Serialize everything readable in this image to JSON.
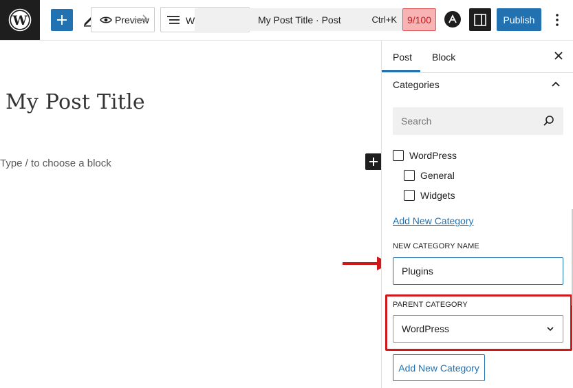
{
  "toolbar": {
    "preview_label": "Preview",
    "list_view_partial": "W",
    "command_bar_title": "My Post Title · Post",
    "command_bar_shortcut": "Ctrl+K",
    "score": "9/100",
    "publish_label": "Publish"
  },
  "editor": {
    "post_title": "My Post Title",
    "block_placeholder": "Type / to choose a block"
  },
  "sidebar": {
    "tabs": [
      {
        "label": "Post",
        "active": true
      },
      {
        "label": "Block",
        "active": false
      }
    ],
    "panel_title": "Categories",
    "search_placeholder": "Search",
    "categories": [
      {
        "label": "WordPress",
        "level": 0,
        "checked": false
      },
      {
        "label": "General",
        "level": 1,
        "checked": false
      },
      {
        "label": "Widgets",
        "level": 1,
        "checked": false
      }
    ],
    "add_new_link": "Add New Category",
    "new_category_label": "NEW CATEGORY NAME",
    "new_category_value": "Plugins",
    "parent_category_label": "PARENT CATEGORY",
    "parent_category_value": "WordPress",
    "add_new_button": "Add New Category"
  },
  "colors": {
    "accent": "#2271b1",
    "highlight": "#d0181a",
    "score_bg": "#f8b4b4"
  },
  "icons": [
    "wordpress-logo-icon",
    "plus-icon",
    "pencil-icon",
    "eye-icon",
    "redo-icon",
    "list-view-icon",
    "astra-icon",
    "sidebar-icon",
    "more-vertical-icon",
    "close-icon",
    "chevron-up-icon",
    "search-icon",
    "chevron-down-icon",
    "arrow-right-icon"
  ]
}
